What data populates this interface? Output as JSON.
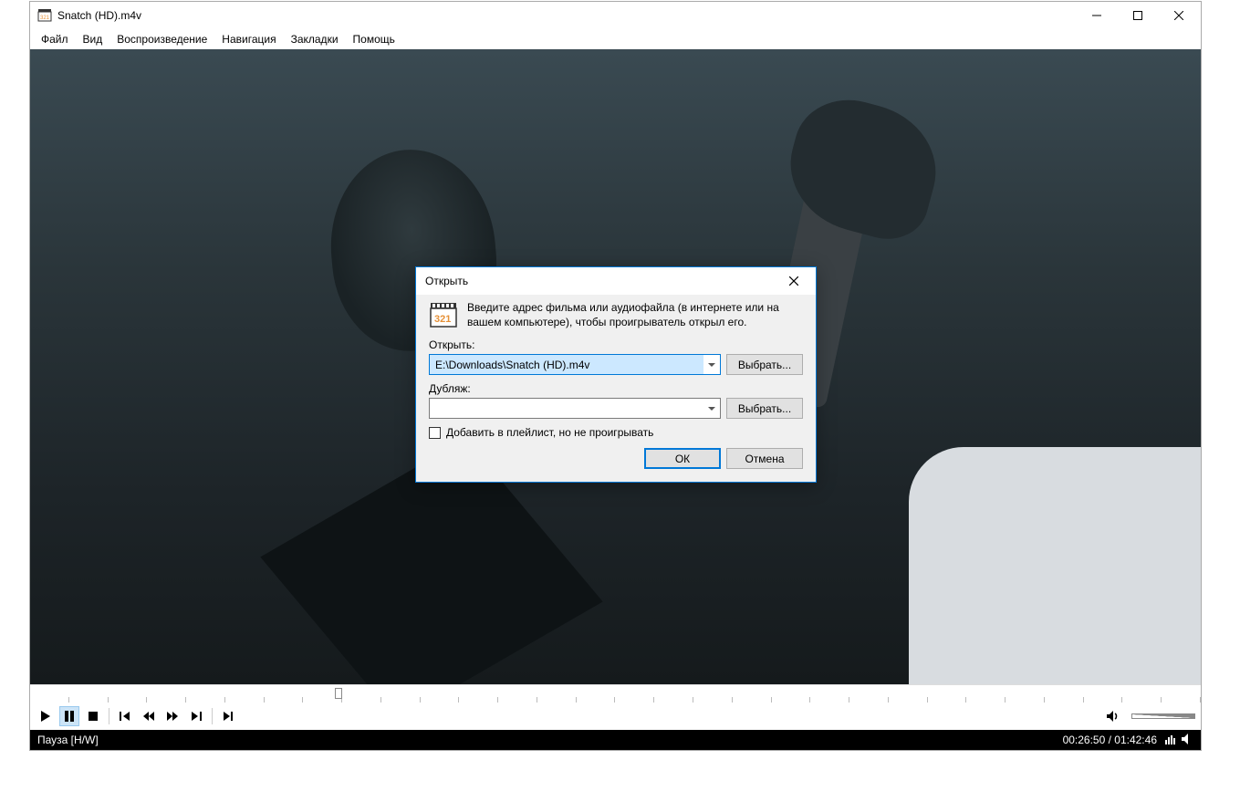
{
  "window": {
    "title": "Snatch (HD).m4v"
  },
  "menu": {
    "items": [
      "Файл",
      "Вид",
      "Воспроизведение",
      "Навигация",
      "Закладки",
      "Помощь"
    ]
  },
  "playback": {
    "progress_fraction": 0.261
  },
  "status": {
    "state": "Пауза [H/W]",
    "time": "00:26:50 / 01:42:46"
  },
  "dialog": {
    "title": "Открыть",
    "description": "Введите адрес фильма или аудиофайла (в интернете или на вашем компьютере), чтобы проигрыватель открыл его.",
    "open_label": "Открыть:",
    "open_value": "E:\\Downloads\\Snatch (HD).m4v",
    "dub_label": "Дубляж:",
    "dub_value": "",
    "browse_label": "Выбрать...",
    "checkbox_label": "Добавить в плейлист, но не проигрывать",
    "ok_label": "ОК",
    "cancel_label": "Отмена"
  }
}
